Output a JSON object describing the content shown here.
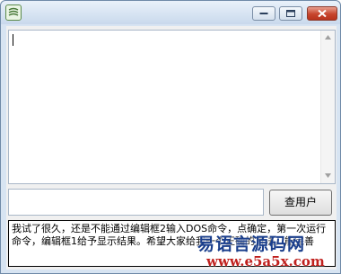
{
  "window": {
    "icon": "app-window-icon",
    "controls": {
      "minimize_icon": "minimize-icon",
      "maximize_icon": "maximize-icon",
      "close_icon": "close-icon"
    }
  },
  "output": {
    "value": ""
  },
  "query": {
    "input_value": "",
    "button_label": "查用户"
  },
  "info": {
    "text": "我试了很久，还是不能通过编辑框2输入DOS命令，点确定，第一次运行命令，编辑框1给予显示结果。希望大家给我一个正确的方法，能完善"
  },
  "watermark": {
    "title": "易语言源码网",
    "url": "www.e5a5x.com"
  },
  "colors": {
    "title_bar": "#c9d9ec",
    "close": "#c7452d",
    "watermark_blue": "#1a3e8c",
    "watermark_red": "#c0201d"
  }
}
